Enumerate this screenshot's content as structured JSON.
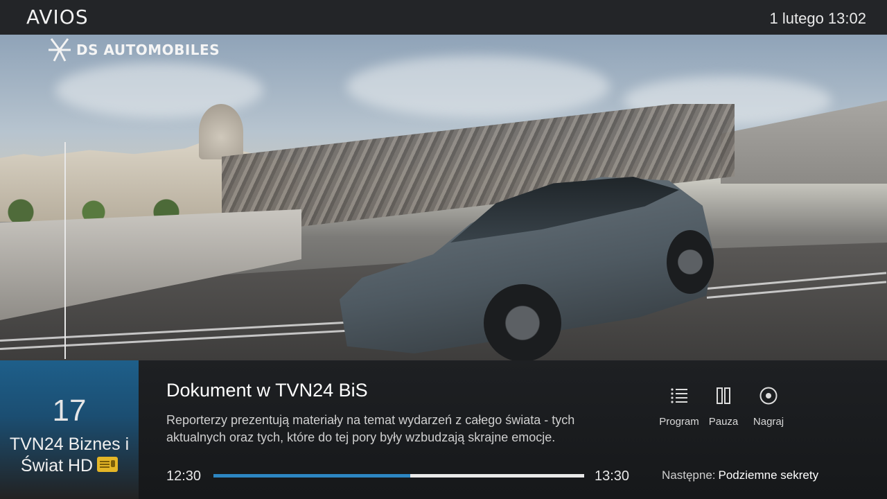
{
  "header": {
    "brand": "AVIOS",
    "clock": "1 lutego 13:02"
  },
  "video": {
    "overlay_logo": "DS AUTOMOBILES"
  },
  "channel": {
    "number": "17",
    "name_line1": "TVN24 Biznes i",
    "name_line2": "Świat HD",
    "badge_icon": "radio-icon"
  },
  "program": {
    "title": "Dokument w TVN24 BiS",
    "description": "Reporterzy prezentują materiały na temat wydarzeń z całego świata - tych aktualnych oraz tych, które do tej pory były wzbudzają skrajne emocje.",
    "start": "12:30",
    "end": "13:30",
    "progress_percent": 53
  },
  "controls": [
    {
      "label": "Program",
      "icon": "list-icon"
    },
    {
      "label": "Pauza",
      "icon": "pause-icon"
    },
    {
      "label": "Nagraj",
      "icon": "record-icon"
    }
  ],
  "next": {
    "label": "Następne:",
    "title": "Podziemne sekrety"
  },
  "colors": {
    "accent": "#2d86c2",
    "channel_bg": "#1e5f8a",
    "badge": "#e4b627"
  }
}
